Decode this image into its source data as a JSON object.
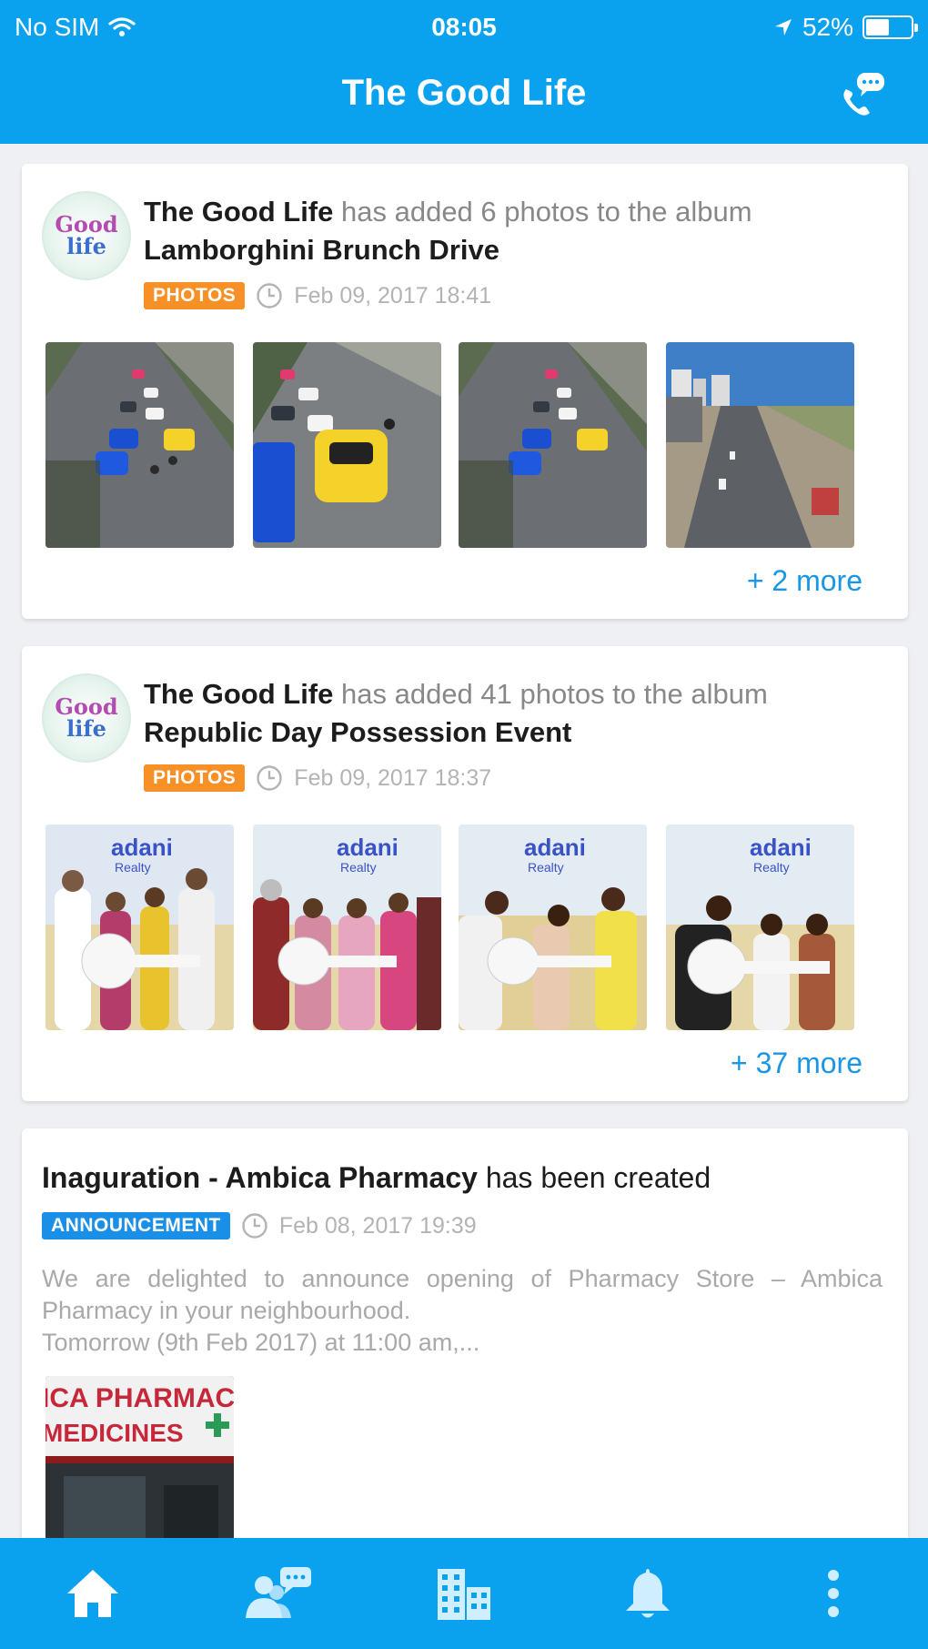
{
  "status_bar": {
    "carrier": "No SIM",
    "time": "08:05",
    "battery": "52%",
    "battery_level": 0.52
  },
  "header": {
    "title": "The Good Life",
    "call_icon": "phone-chat-icon"
  },
  "feed": {
    "posts": [
      {
        "author": "The Good Life",
        "action": "has added 6 photos to the album",
        "album": "Lamborghini Brunch Drive",
        "badge": "PHOTOS",
        "timestamp": "Feb 09, 2017 18:41",
        "more": "+ 2 more"
      },
      {
        "author": "The Good Life",
        "action": "has added 41 photos to the album",
        "album": "Republic Day Possession Event",
        "badge": "PHOTOS",
        "timestamp": "Feb 09, 2017 18:37",
        "more": "+ 37 more"
      }
    ],
    "announcement": {
      "title": "Inaguration - Ambica Pharmacy",
      "suffix": "has been created",
      "badge": "ANNOUNCEMENT",
      "timestamp": "Feb 08, 2017 19:39",
      "body_line1": "We are delighted to announce opening of Pharmacy Store – Ambica Pharmacy in your neighbourhood.",
      "body_line2": "Tomorrow (9th Feb 2017) at 11:00 am,...",
      "image_text1": "ICA PHARMAC",
      "image_text2": "MEDICINES"
    },
    "avatar_text1": "Good",
    "avatar_text2": "life",
    "event_logo": "adani",
    "event_logo_sub": "Realty"
  },
  "colors": {
    "brand": "#0aa2ee",
    "photos_badge": "#f79027",
    "announcement_badge": "#1a8fe8",
    "link": "#1a96e6"
  },
  "tabbar": {
    "icons": [
      "home-icon",
      "community-chat-icon",
      "buildings-icon",
      "bell-icon",
      "more-vertical-icon"
    ]
  }
}
